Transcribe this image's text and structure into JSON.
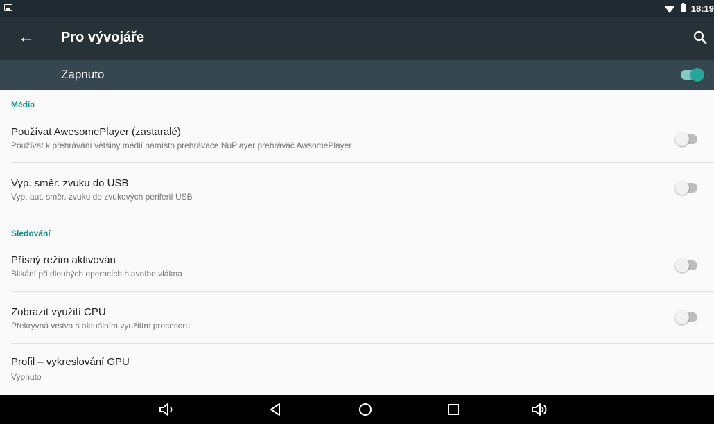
{
  "statusbar": {
    "time": "18:19"
  },
  "appbar": {
    "title": "Pro vývojáře"
  },
  "master": {
    "label": "Zapnuto",
    "enabled": true
  },
  "sections": [
    {
      "label": "Média"
    },
    {
      "label": "Sledování"
    }
  ],
  "items": [
    {
      "title": "Používat AwesomePlayer (zastaralé)",
      "subtitle": "Používat k přehrávání většiny médií namísto přehrávače NuPlayer přehrávač AwsomePlayer",
      "checked": false
    },
    {
      "title": "Vyp. směr. zvuku do USB",
      "subtitle": "Vyp. aut. směr. zvuku do zvukových periferií USB",
      "checked": false
    },
    {
      "title": "Přísný režim aktivován",
      "subtitle": "Blikání při dlouhých operacích hlavního vlákna",
      "checked": false
    },
    {
      "title": "Zobrazit využití CPU",
      "subtitle": "Překryvná vrstva s aktuálním využitím procesoru",
      "checked": false
    },
    {
      "title": "Profil – vykreslování GPU",
      "subtitle": "Vypnuto"
    }
  ],
  "colors": {
    "accent": "#009688",
    "appbar": "#263238",
    "masterbar": "#37474f",
    "toggle_on": "#26a69a"
  },
  "nav_icons": [
    "volume-down-icon",
    "back-icon",
    "home-icon",
    "recents-icon",
    "volume-up-icon"
  ]
}
